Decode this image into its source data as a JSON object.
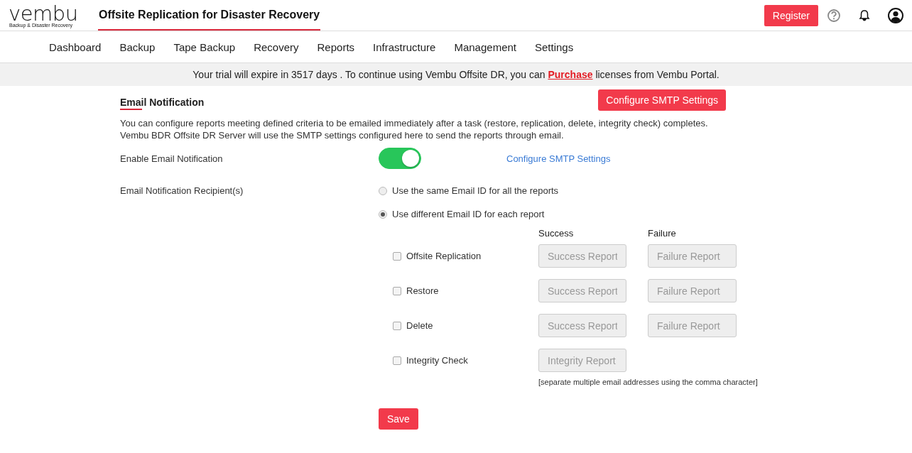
{
  "header": {
    "logo": "vembu",
    "logo_tagline": "Backup & Disaster Recovery",
    "title": "Offsite Replication for Disaster Recovery",
    "register": "Register"
  },
  "nav": [
    "Dashboard",
    "Backup",
    "Tape Backup",
    "Recovery",
    "Reports",
    "Infrastructure",
    "Management",
    "Settings"
  ],
  "banner": {
    "text_before": "Your trial will expire in 3517 days . To continue using Vembu Offsite DR, you can ",
    "link": "Purchase",
    "text_after": " licenses from Vembu Portal."
  },
  "section": {
    "title": "Email Notification",
    "smtp_button": "Configure SMTP Settings",
    "description": [
      "You can configure reports meeting defined criteria to be emailed immediately after a task (restore, replication, delete, integrity check) completes.",
      "Vembu BDR Offsite DR Server will use the SMTP settings configured here to send the reports through email."
    ]
  },
  "enable": {
    "label": "Enable Email Notification",
    "on": true,
    "link": "Configure SMTP Settings"
  },
  "recipients": {
    "label": "Email Notification Recipient(s)",
    "options": [
      {
        "label": "Use the same Email ID for all the reports",
        "selected": false
      },
      {
        "label": "Use different Email ID for each report",
        "selected": true
      }
    ]
  },
  "report_columns": [
    "Success",
    "Failure"
  ],
  "reports": [
    {
      "label": "Offsite Replication",
      "checked": false,
      "fields": [
        {
          "placeholder": "Success Report",
          "disabled": true
        },
        {
          "placeholder": "Failure Report",
          "disabled": true
        }
      ]
    },
    {
      "label": "Restore",
      "checked": false,
      "fields": [
        {
          "placeholder": "Success Report",
          "disabled": true
        },
        {
          "placeholder": "Failure Report",
          "disabled": true
        }
      ]
    },
    {
      "label": "Delete",
      "checked": false,
      "fields": [
        {
          "placeholder": "Success Report",
          "disabled": true
        },
        {
          "placeholder": "Failure Report",
          "disabled": true
        }
      ]
    },
    {
      "label": "Integrity Check",
      "checked": false,
      "fields": [
        {
          "placeholder": "Integrity Report",
          "disabled": true
        }
      ]
    }
  ],
  "hint": "[separate multiple email addresses using the comma character]",
  "save": "Save"
}
